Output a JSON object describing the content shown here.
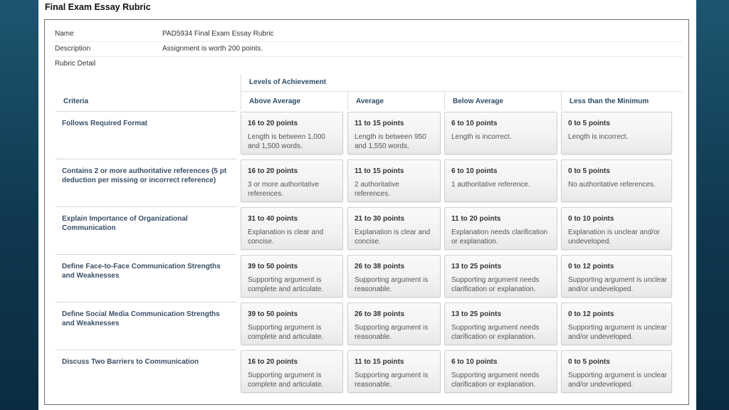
{
  "page_title": "Final Exam Essay Rubric",
  "meta": [
    {
      "label": "Name",
      "value": "PAD5934 Final Exam Essay Rubric"
    },
    {
      "label": "Description",
      "value": "Assignment is worth 200 points."
    },
    {
      "label": "Rubric Detail",
      "value": ""
    }
  ],
  "levels_title": "Levels of Achievement",
  "columns": {
    "criteria": "Criteria",
    "levels": [
      "Above Average",
      "Average",
      "Below Average",
      "Less than the Minimum"
    ]
  },
  "rows": [
    {
      "criterion": "Follows Required Format",
      "cells": [
        {
          "points": "16 to 20 points",
          "desc": "Length is between 1,000 and 1,500 words."
        },
        {
          "points": "11 to 15 points",
          "desc": "Length is between 950 and 1,550 words."
        },
        {
          "points": "6 to 10 points",
          "desc": "Length is incorrect."
        },
        {
          "points": "0 to 5 points",
          "desc": "Length is incorrect."
        }
      ]
    },
    {
      "criterion": "Contains 2 or more authoritative references (5 pt deduction per missing or incorrect reference)",
      "cells": [
        {
          "points": "16 to 20 points",
          "desc": "3 or more authoritative references."
        },
        {
          "points": "11 to 15 points",
          "desc": "2 authoritative references."
        },
        {
          "points": "6 to 10 points",
          "desc": "1 authoritative reference."
        },
        {
          "points": "0 to 5 points",
          "desc": "No authoritative references."
        }
      ]
    },
    {
      "criterion": "Explain Importance of Organizational Communication",
      "cells": [
        {
          "points": "31 to 40 points",
          "desc": "Explanation is clear and concise."
        },
        {
          "points": "21 to 30 points",
          "desc": "Explanation is clear and concise."
        },
        {
          "points": "11 to 20 points",
          "desc": "Explanation needs clarification or explanation."
        },
        {
          "points": "0 to 10 points",
          "desc": "Explanation is unclear and/or undeveloped."
        }
      ]
    },
    {
      "criterion": "Define Face-to-Face Communication Strengths and Weaknesses",
      "cells": [
        {
          "points": "39 to 50 points",
          "desc": "Supporting argument is complete and articulate."
        },
        {
          "points": "26 to 38 points",
          "desc": "Supporting argument is reasonable."
        },
        {
          "points": "13 to 25 points",
          "desc": "Supporting argument needs clarification or explanation."
        },
        {
          "points": "0 to 12 points",
          "desc": "Supporting argument is unclear and/or undeveloped."
        }
      ]
    },
    {
      "criterion": "Define Social Media Communication Strengths and Weaknesses",
      "cells": [
        {
          "points": "39 to 50 points",
          "desc": "Supporting argument is complete and articulate."
        },
        {
          "points": "26 to 38 points",
          "desc": "Supporting argument is reasonable."
        },
        {
          "points": "13 to 25 points",
          "desc": "Supporting argument needs clarification or explanation."
        },
        {
          "points": "0 to 12 points",
          "desc": "Supporting argument is unclear and/or undeveloped."
        }
      ]
    },
    {
      "criterion": "Discuss Two Barriers to Communication",
      "cells": [
        {
          "points": "16 to 20 points",
          "desc": "Supporting argument is complete and articulate."
        },
        {
          "points": "11 to 15 points",
          "desc": "Supporting argument is reasonable."
        },
        {
          "points": "6 to 10 points",
          "desc": "Supporting argument needs clarification or explanation."
        },
        {
          "points": "0 to 5 points",
          "desc": "Supporting argument is unclear and/or undeveloped."
        }
      ]
    }
  ]
}
